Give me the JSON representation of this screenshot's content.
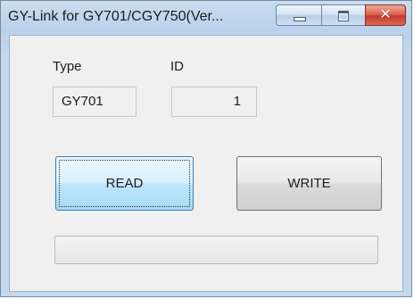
{
  "window": {
    "title": "GY-Link for GY701/CGY750(Ver...",
    "controls": {
      "minimize_icon": "minimize-icon",
      "maximize_icon": "maximize-icon",
      "close_icon": "close-icon",
      "close_glyph": "✕"
    }
  },
  "form": {
    "type_label": "Type",
    "type_value": "GY701",
    "id_label": "ID",
    "id_value": "1"
  },
  "buttons": {
    "read_label": "READ",
    "write_label": "WRITE"
  },
  "progress": {
    "value": 0
  },
  "colors": {
    "close_button": "#c7392a",
    "focused_button": "#3c7fb1",
    "progress_fill": "#06b025"
  }
}
